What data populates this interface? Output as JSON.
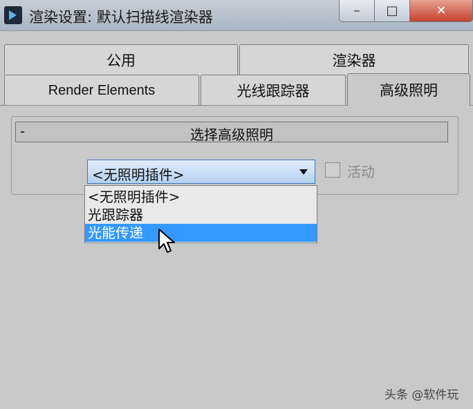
{
  "window": {
    "title": "渲染设置: 默认扫描线渲染器",
    "buttons": {
      "minimize": "–",
      "maximize": "□",
      "close": "✕"
    }
  },
  "tabs": {
    "row1": [
      "公用",
      "渲染器"
    ],
    "row2": [
      "Render Elements",
      "光线跟踪器",
      "高级照明"
    ],
    "active": "高级照明"
  },
  "rollout": {
    "toggle": "-",
    "title": "选择高级照明"
  },
  "plugin_select": {
    "value": "<无照明插件>",
    "options": [
      "<无照明插件>",
      "光跟踪器",
      "光能传递"
    ],
    "highlighted": "光能传递"
  },
  "active_checkbox": {
    "label": "活动",
    "checked": false,
    "enabled": false
  },
  "watermark": "头条 @软件玩"
}
